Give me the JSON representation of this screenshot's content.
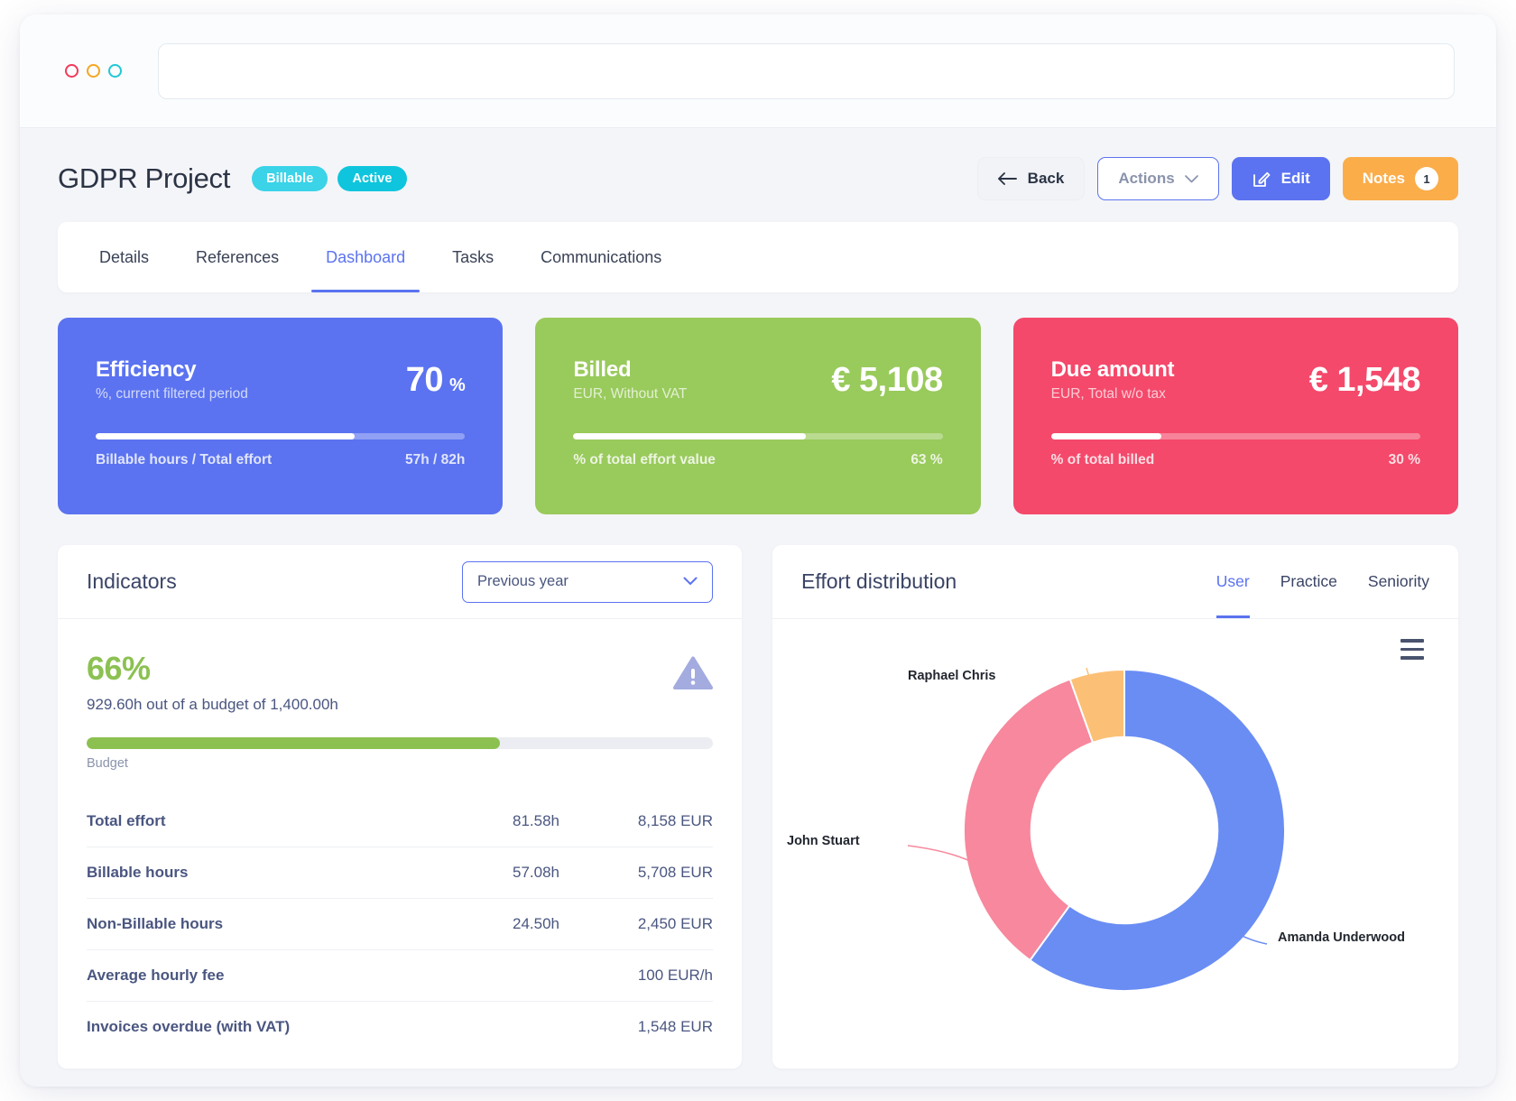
{
  "browser": {
    "lights": [
      "red",
      "amber",
      "teal"
    ],
    "url_value": "",
    "url_placeholder": ""
  },
  "header": {
    "title": "GDPR Project",
    "pills": [
      {
        "label": "Billable",
        "color": "#3ad3e8"
      },
      {
        "label": "Active",
        "color": "#0ec5dd"
      }
    ],
    "buttons": {
      "back": "Back",
      "actions": "Actions",
      "edit": "Edit",
      "notes": "Notes",
      "notes_badge": "1"
    }
  },
  "tabs": [
    {
      "label": "Details",
      "selected": false
    },
    {
      "label": "References",
      "selected": false
    },
    {
      "label": "Dashboard",
      "selected": true
    },
    {
      "label": "Tasks",
      "selected": false
    },
    {
      "label": "Communications",
      "selected": false
    }
  ],
  "kpis": [
    {
      "name": "Efficiency",
      "subtitle": "%, current filtered period",
      "value": "70",
      "unit": "%",
      "color": "#5b73f0",
      "progress": 70,
      "foot_left": "Billable hours / Total effort",
      "foot_right": "57h / 82h"
    },
    {
      "name": "Billed",
      "subtitle": "EUR, Without VAT",
      "value": "€ 5,108",
      "unit": "",
      "color": "#99ca5c",
      "progress": 63,
      "foot_left": "% of total effort value",
      "foot_right": "63 %"
    },
    {
      "name": "Due amount",
      "subtitle": "EUR, Total w/o tax",
      "value": "€ 1,548",
      "unit": "",
      "color": "#f4496b",
      "progress": 30,
      "foot_left": "% of total billed",
      "foot_right": "30 %"
    }
  ],
  "indicators": {
    "title": "Indicators",
    "period_select": {
      "value": "Previous year"
    },
    "budget": {
      "percent_label": "66%",
      "percent_value": 66,
      "description": "929.60h out of a budget of 1,400.00h",
      "bar_label": "Budget",
      "accent": "#8cc152"
    },
    "rows": [
      {
        "label": "Total effort",
        "hours": "81.58h",
        "amount": "8,158 EUR"
      },
      {
        "label": "Billable hours",
        "hours": "57.08h",
        "amount": "5,708 EUR"
      },
      {
        "label": "Non-Billable hours",
        "hours": "24.50h",
        "amount": "2,450 EUR"
      },
      {
        "label": "Average hourly fee",
        "hours": "",
        "amount": "100 EUR/h"
      },
      {
        "label": "Invoices overdue (with VAT)",
        "hours": "",
        "amount": "1,548 EUR"
      }
    ]
  },
  "effort": {
    "title": "Effort distribution",
    "tabs": [
      {
        "label": "User",
        "selected": true
      },
      {
        "label": "Practice",
        "selected": false
      },
      {
        "label": "Seniority",
        "selected": false
      }
    ]
  },
  "chart_data": {
    "type": "pie",
    "variant": "donut",
    "title": "Effort distribution",
    "legend": "labels-outside",
    "grid": false,
    "labels": [
      "Amanda Underwood",
      "John Stuart",
      "Raphael Chris"
    ],
    "values": [
      60.0,
      34.5,
      5.5
    ],
    "colors": [
      "#6a8df4",
      "#f7889d",
      "#fbc076"
    ],
    "inner_radius_ratio": 0.58,
    "start_angle": 0,
    "annotations": [
      {
        "text": "Raphael Chris",
        "position": "top"
      },
      {
        "text": "John Stuart",
        "position": "left"
      },
      {
        "text": "Amanda Underwood",
        "position": "right"
      }
    ]
  }
}
